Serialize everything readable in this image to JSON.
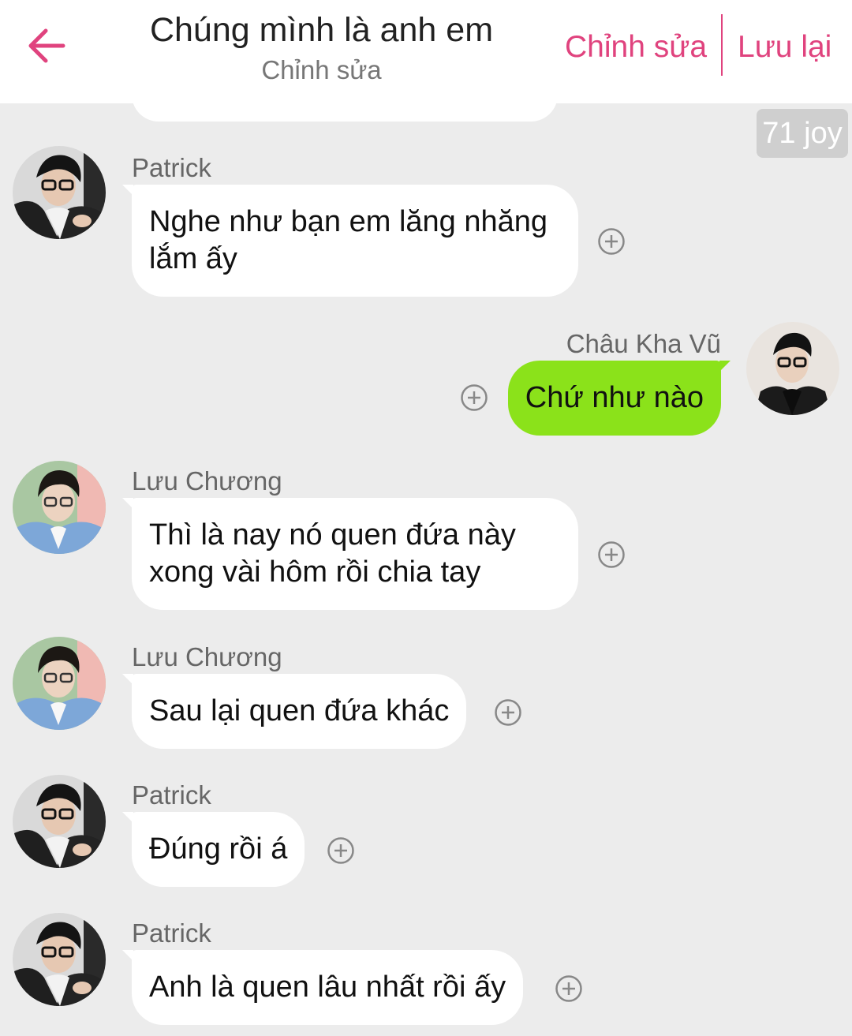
{
  "header": {
    "title": "Chúng mình là anh em",
    "subtitle": "Chỉnh sửa",
    "edit_label": "Chỉnh sửa",
    "save_label": "Lưu lại",
    "accent_color": "#e0437e"
  },
  "joy_badge": "71 joy",
  "messages": [
    {
      "sender": "Patrick",
      "text": "Nghe như bạn em lăng nhăng lắm ấy",
      "side": "left"
    },
    {
      "sender": "Châu Kha Vũ",
      "text": "Chứ như nào",
      "side": "right"
    },
    {
      "sender": "Lưu Chương",
      "text": "Thì là nay nó quen đứa này xong vài hôm rồi chia tay",
      "side": "left"
    },
    {
      "sender": "Lưu Chương",
      "text": "Sau lại quen đứa khác",
      "side": "left"
    },
    {
      "sender": "Patrick",
      "text": "Đúng rồi á",
      "side": "left"
    },
    {
      "sender": "Patrick",
      "text": "Anh là quen lâu nhất rồi ấy",
      "side": "left"
    }
  ],
  "icons": {
    "back": "arrow-left-icon",
    "add_reaction": "plus-circle-icon"
  },
  "colors": {
    "own_bubble": "#8be21a",
    "other_bubble": "#ffffff",
    "background": "#ececec"
  }
}
